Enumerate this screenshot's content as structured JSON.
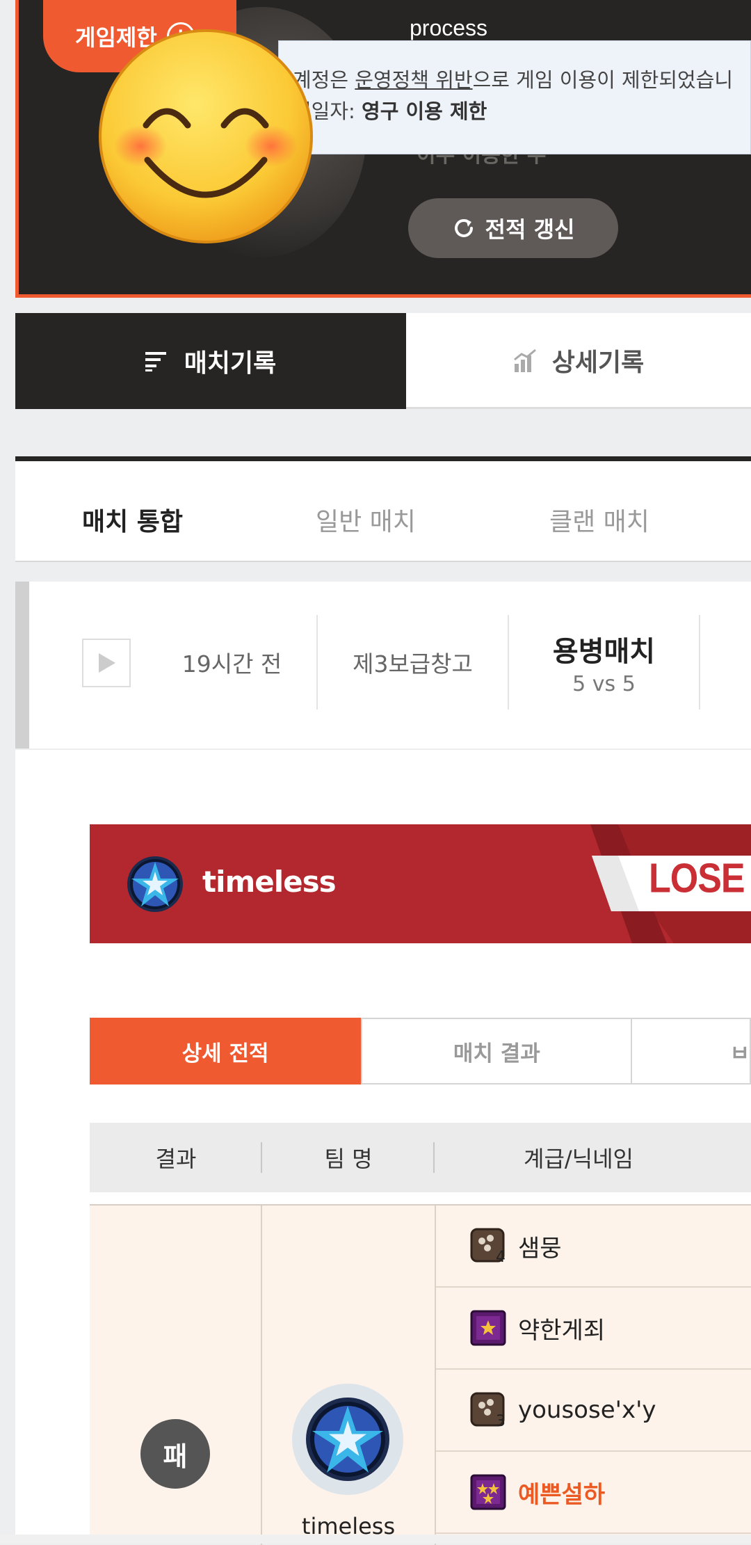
{
  "profile": {
    "username": "process",
    "restriction_badge": "게임제한",
    "notice_prefix": "계정은 ",
    "notice_link": "운영정책 위반",
    "notice_suffix": "으로 게임 이용이 제한되었습니",
    "notice_date_label": "정일자: ",
    "notice_date_value": "영구 이용 제한",
    "status_text": "이수 이용한 수",
    "refresh_button": "전적 갱신"
  },
  "main_tabs": {
    "match_history": "매치기록",
    "detail_history": "상세기록"
  },
  "sub_tabs": [
    "매치 통합",
    "일반 매치",
    "클랜 매치"
  ],
  "match": {
    "time": "19시간 전",
    "map": "제3보급창고",
    "mode": "용병매치",
    "format": "5 vs 5"
  },
  "team_banner": {
    "team_name": "timeless",
    "result": "LOSE"
  },
  "detail_tabs": [
    "상세 전적",
    "매치 결과",
    "ㅂ"
  ],
  "table": {
    "headers": [
      "결과",
      "팀 명",
      "계급/닉네임"
    ],
    "result_badge": "패",
    "team_name": "timeless",
    "players": [
      {
        "name": "샘뭉",
        "rank_number": "4",
        "highlight": false
      },
      {
        "name": "약한게죄",
        "rank_number": "",
        "highlight": false
      },
      {
        "name": "yousose'x'y",
        "rank_number": "3",
        "highlight": false
      },
      {
        "name": "예쁜설하",
        "rank_number": "",
        "highlight": true
      }
    ]
  },
  "colors": {
    "accent": "#f05a31",
    "dark": "#262524",
    "banner_red": "#b3282e",
    "highlight_name": "#ea5a22"
  },
  "icons": [
    "info-icon",
    "refresh-icon",
    "list-icon",
    "bar-chart-icon",
    "play-icon",
    "team-emblem-icon",
    "rank-icon",
    "smiley-emoji"
  ]
}
